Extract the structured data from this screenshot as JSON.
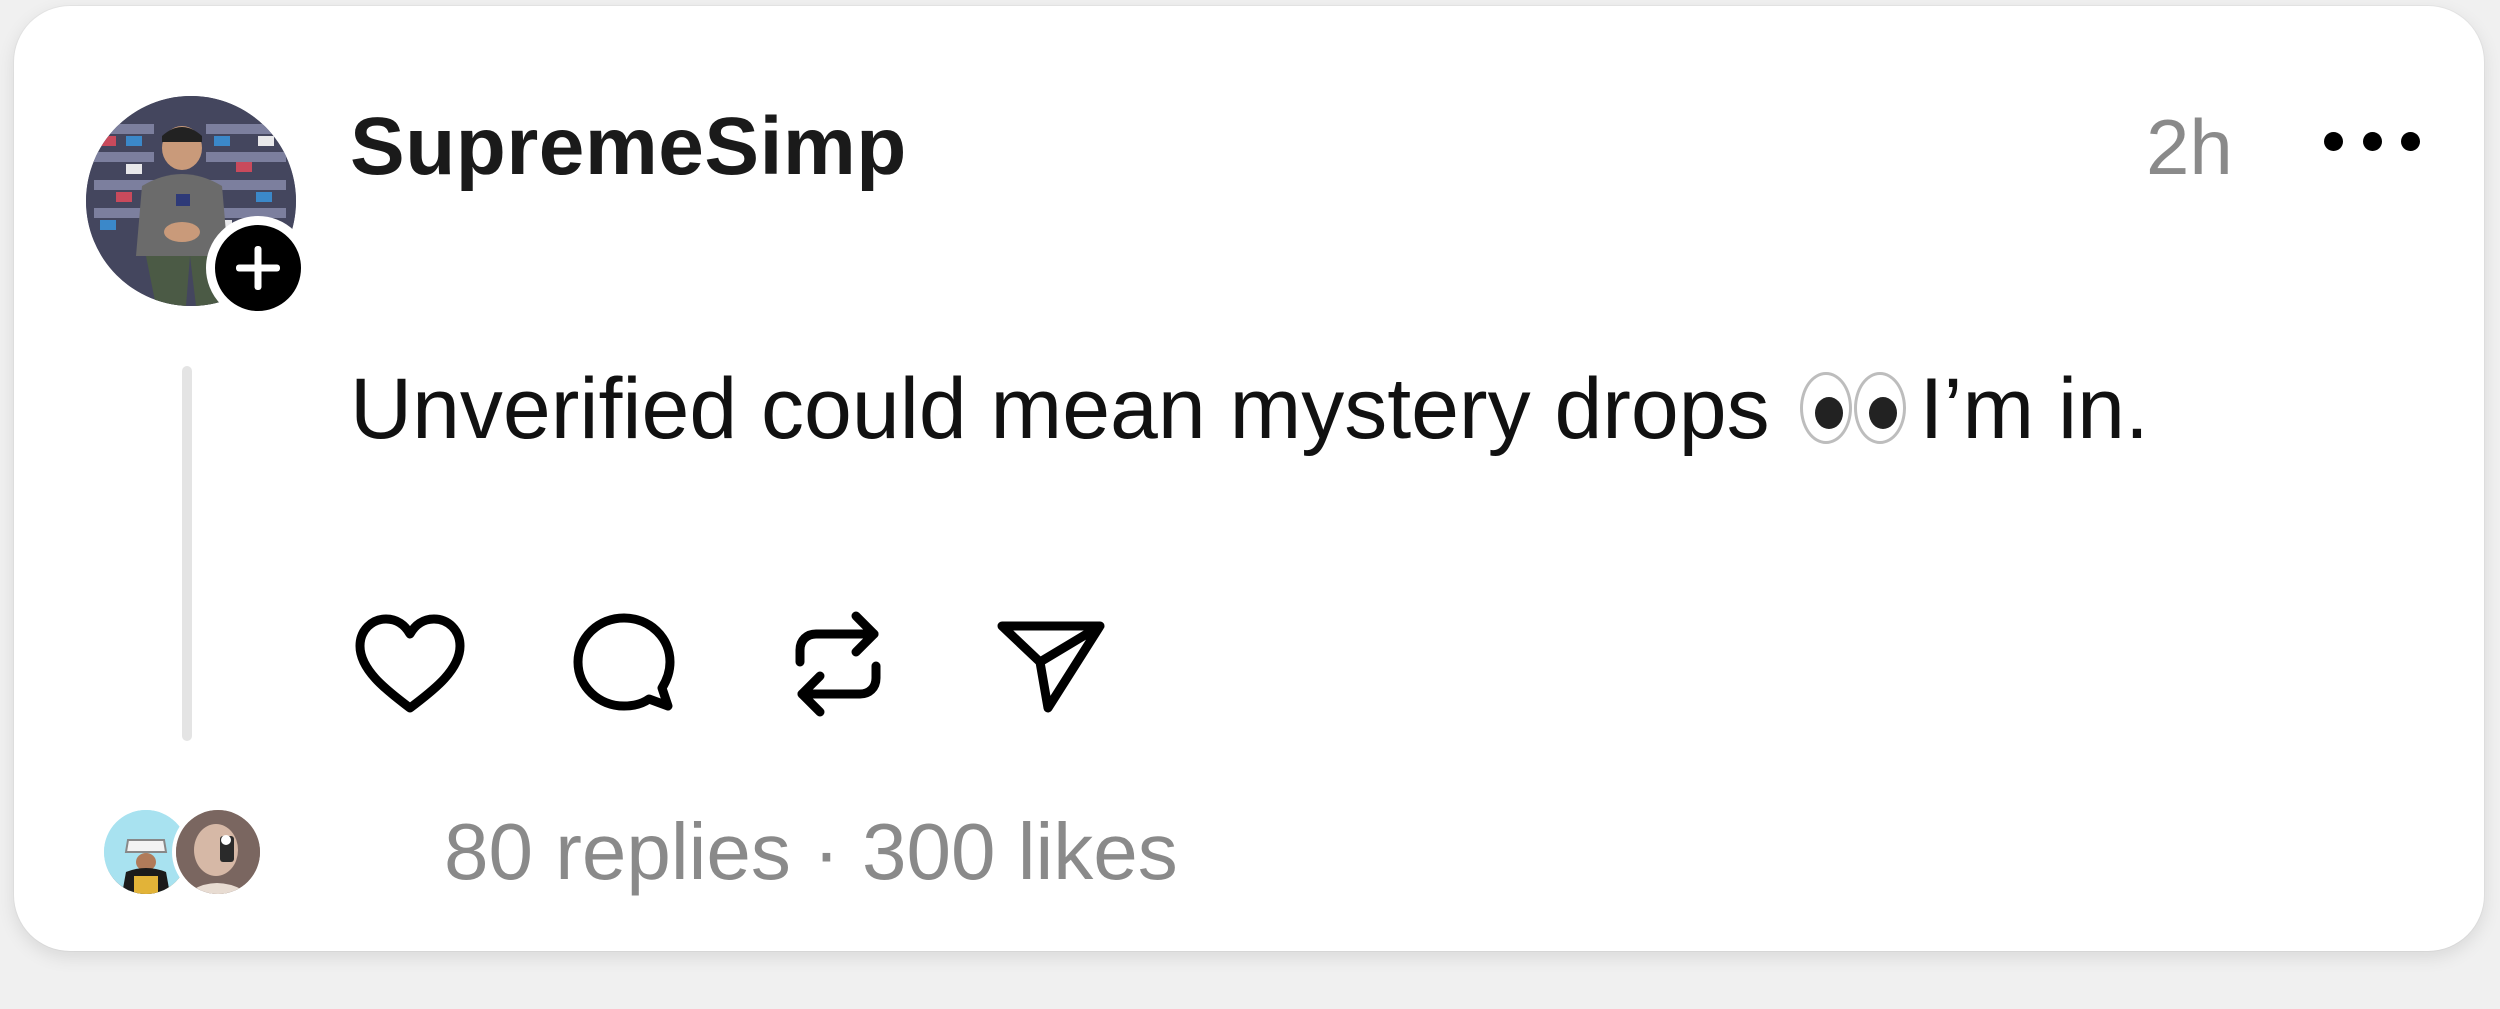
{
  "post": {
    "username": "SupremeSimp",
    "timestamp": "2h",
    "text_before": "Unverified could mean mystery drops",
    "text_after": "I’m in.",
    "emoji": "eyes-emoji"
  },
  "icons": {
    "follow": "plus-icon",
    "more": "more-horizontal-icon",
    "like": "heart-icon",
    "reply": "comment-icon",
    "repost": "repost-icon",
    "share": "send-icon"
  },
  "footer": {
    "replies": "80 replies",
    "separator": "·",
    "likes": "300 likes"
  },
  "colors": {
    "muted_text": "#8a8a8a",
    "primary_text": "#111111",
    "thread_line": "#e4e4e4"
  }
}
